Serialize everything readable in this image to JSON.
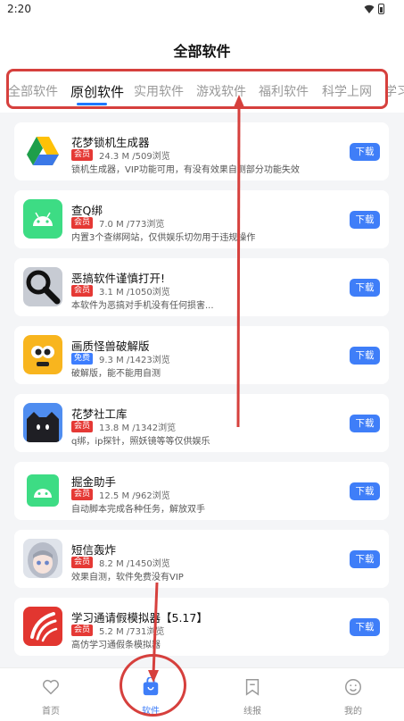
{
  "status": {
    "time": "2:20"
  },
  "header": {
    "title": "全部软件"
  },
  "tabs": [
    {
      "label": "全部软件"
    },
    {
      "label": "原创软件"
    },
    {
      "label": "实用软件"
    },
    {
      "label": "游戏软件"
    },
    {
      "label": "福利软件"
    },
    {
      "label": "科学上网"
    },
    {
      "label": "学习"
    }
  ],
  "apps": [
    {
      "name": "花梦锁机生成器",
      "badge": "会员",
      "meta": "24.3 M /509浏览",
      "desc": "锁机生成器，VIP功能可用，有没有效果自测部分功能失效",
      "action": "下载"
    },
    {
      "name": "查Q绑",
      "badge": "会员",
      "meta": "7.0 M /773浏览",
      "desc": "内置3个查绑网站，仅供娱乐切勿用于违规操作",
      "action": "下载"
    },
    {
      "name": "恶搞软件谨慎打开!",
      "badge": "会员",
      "meta": "3.1 M /1050浏览",
      "desc": "本软件为恶搞对手机没有任何损害...",
      "action": "下载"
    },
    {
      "name": "画质怪兽破解版",
      "badge": "免费",
      "meta": "9.3 M /1423浏览",
      "desc": "破解版，能不能用自测",
      "action": "下载"
    },
    {
      "name": "花梦社工库",
      "badge": "会员",
      "meta": "13.8 M /1342浏览",
      "desc": "q绑，ip探针，照妖镜等等仅供娱乐",
      "action": "下载"
    },
    {
      "name": "掘金助手",
      "badge": "会员",
      "meta": "12.5 M /962浏览",
      "desc": "自动脚本完成各种任务，解放双手",
      "action": "下载"
    },
    {
      "name": "短信轰炸",
      "badge": "会员",
      "meta": "8.2 M /1450浏览",
      "desc": "效果自测，软件免费没有VIP",
      "action": "下载"
    },
    {
      "name": "学习通请假模拟器【5.17】",
      "badge": "会员",
      "meta": "5.2 M /731浏览",
      "desc": "高仿学习通假条模拟器",
      "action": "下载"
    }
  ],
  "nav": [
    {
      "label": "首页"
    },
    {
      "label": "软件"
    },
    {
      "label": "线报"
    },
    {
      "label": "我的"
    }
  ],
  "colors": {
    "accent": "#3f7ef8",
    "member_badge": "#e53935",
    "free_badge": "#3d7eff",
    "annotation": "#d6403d"
  }
}
